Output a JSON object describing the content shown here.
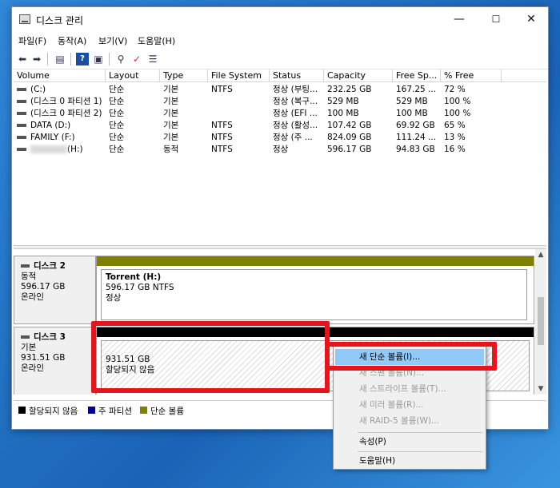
{
  "window": {
    "title": "디스크 관리"
  },
  "window_controls": {
    "minimize": "—",
    "maximize": "☐",
    "close": "✕"
  },
  "menu": [
    "파일(F)",
    "동작(A)",
    "보기(V)",
    "도움말(H)"
  ],
  "table": {
    "headers": [
      "Volume",
      "Layout",
      "Type",
      "File System",
      "Status",
      "Capacity",
      "Free Sp...",
      "% Free"
    ],
    "rows": [
      [
        "(C:)",
        "단순",
        "기본",
        "NTFS",
        "정상 (부팅...",
        "232.25 GB",
        "167.25 ...",
        "72 %"
      ],
      [
        "(디스크 0 파티션 1)",
        "단순",
        "기본",
        "",
        "정상 (복구...",
        "529 MB",
        "529 MB",
        "100 %"
      ],
      [
        "(디스크 0 파티션 2)",
        "단순",
        "기본",
        "",
        "정상 (EFI ...",
        "100 MB",
        "100 MB",
        "100 %"
      ],
      [
        "DATA (D:)",
        "단순",
        "기본",
        "NTFS",
        "정상 (활성...",
        "107.42 GB",
        "69.92 GB",
        "65 %"
      ],
      [
        "FAMILY (F:)",
        "단순",
        "기본",
        "NTFS",
        "정상 (주 ...",
        "824.09 GB",
        "111.24 ...",
        "13 %"
      ],
      [
        "(H:)",
        "단순",
        "동적",
        "NTFS",
        "정상",
        "596.17 GB",
        "94.83 GB",
        "16 %"
      ]
    ]
  },
  "disks": [
    {
      "name": "디스크 2",
      "type": "동적",
      "size": "596.17 GB",
      "state": "온라인",
      "partition": {
        "label": "Torrent  (H:)",
        "detail": "596.17 GB NTFS",
        "status": "정상"
      }
    },
    {
      "name": "디스크 3",
      "type": "기본",
      "size": "931.51 GB",
      "state": "온라인",
      "partition": {
        "detail": "931.51 GB",
        "status": "할당되지 않음"
      }
    }
  ],
  "legend": [
    {
      "label": "할당되지 않음",
      "color": "#000000"
    },
    {
      "label": "주 파티션",
      "color": "#00008b"
    },
    {
      "label": "단순 볼륨",
      "color": "#808000"
    }
  ],
  "context_menu": {
    "items": [
      {
        "label": "새 단순 볼륨(I)...",
        "enabled": true,
        "highlighted": true
      },
      {
        "label": "새 스팬 볼륨(N)...",
        "enabled": false
      },
      {
        "label": "새 스트라이프 볼륨(T)...",
        "enabled": false
      },
      {
        "label": "새 미러 볼륨(R)...",
        "enabled": false
      },
      {
        "label": "새 RAID-5 볼륨(W)...",
        "enabled": false
      },
      {
        "label": "속성(P)",
        "enabled": true
      },
      {
        "label": "도움말(H)",
        "enabled": true
      }
    ]
  },
  "colors": {
    "highlight_box": "#e8141b",
    "menu_highlight": "#91c9f7"
  }
}
